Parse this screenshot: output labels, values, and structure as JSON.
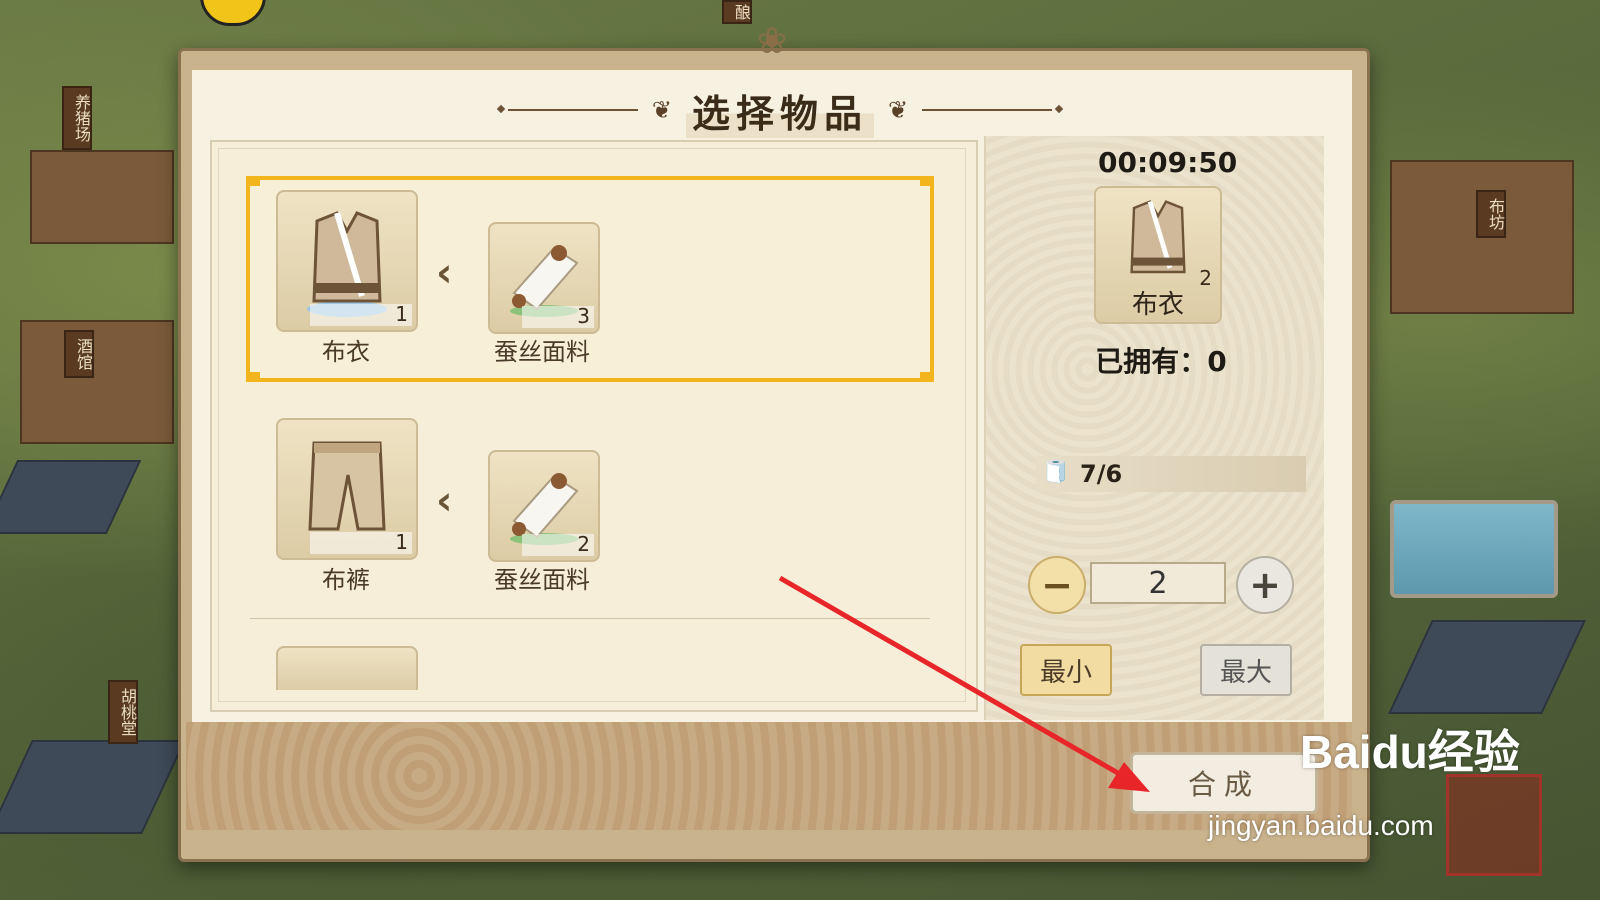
{
  "world": {
    "signs": [
      "养猪场",
      "酒馆",
      "胡桃堂",
      "布坊",
      "酿"
    ]
  },
  "dialog": {
    "title": "选择物品",
    "recipes": [
      {
        "product": {
          "name": "布衣",
          "quantity": "1"
        },
        "material": {
          "name": "蚕丝面料",
          "quantity": "3"
        },
        "selected": true
      },
      {
        "product": {
          "name": "布裤",
          "quantity": "1"
        },
        "material": {
          "name": "蚕丝面料",
          "quantity": "2"
        },
        "selected": false
      }
    ],
    "detail": {
      "timer": "00:09:50",
      "item_name": "布衣",
      "item_quantity": "2",
      "owned_label": "已拥有：0",
      "material_count": "7/6",
      "quantity_value": "2",
      "min_label": "最小",
      "max_label": "最大"
    },
    "craft_button_label": "合成"
  },
  "watermark": {
    "logo": "Baidu经验",
    "url": "jingyan.baidu.com"
  },
  "colors": {
    "selection": "#f2b51c",
    "annotation_arrow": "#e8262a"
  }
}
